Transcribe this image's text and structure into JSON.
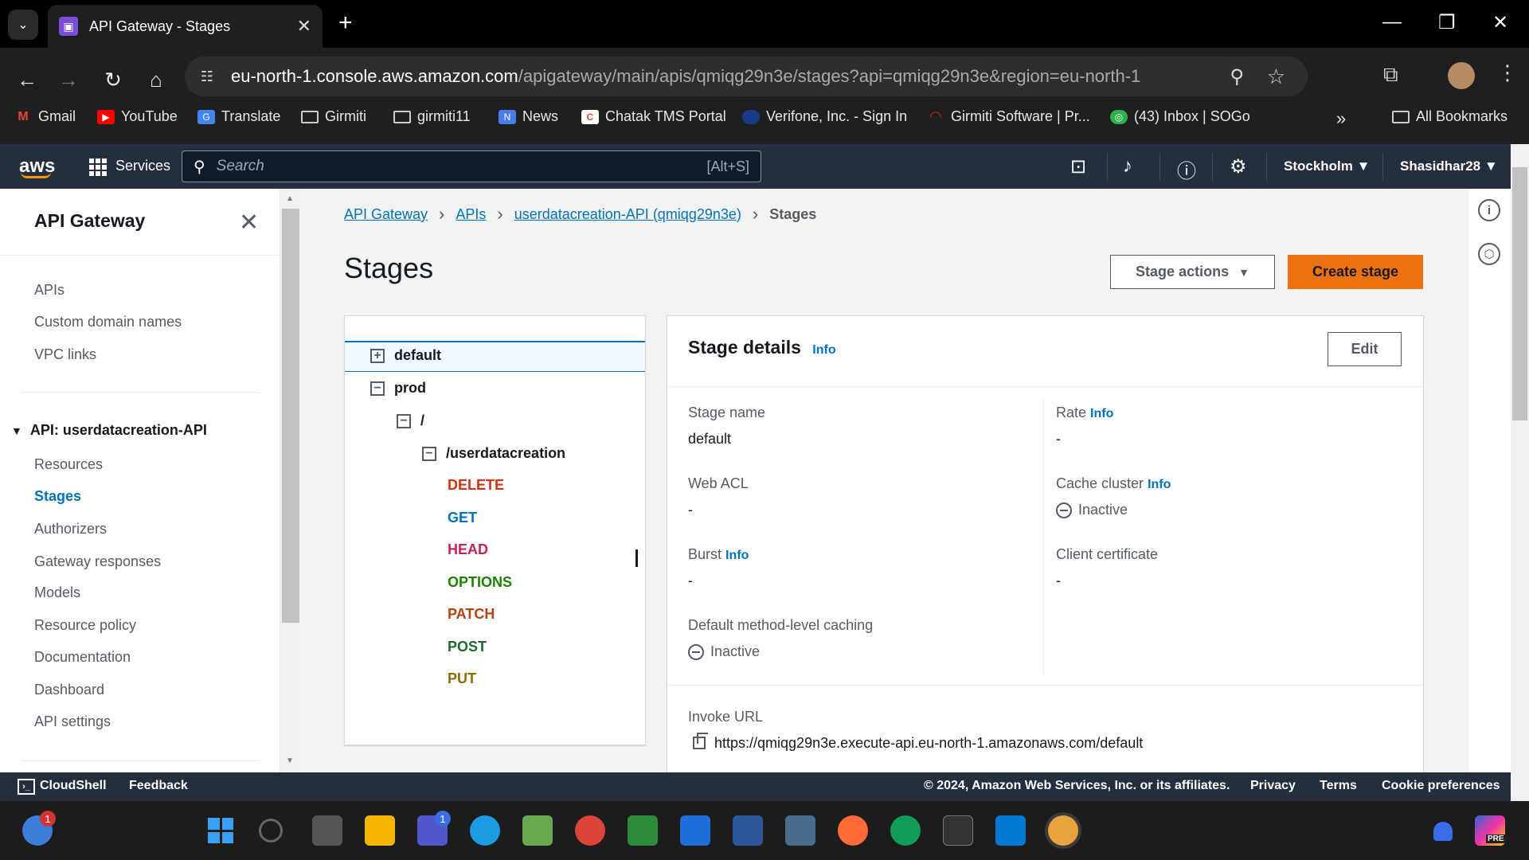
{
  "browser": {
    "tab_title": "API Gateway - Stages",
    "tab_close": "✕",
    "new_tab": "+",
    "url_host": "eu-north-1.console.aws.amazon.com",
    "url_path": "/apigateway/main/apis/qmiqg29n3e/stages?api=qmiqg29n3e&region=eu-north-1",
    "bookmarks": [
      {
        "label": "Gmail",
        "color": "#ea4335",
        "glyph": "M"
      },
      {
        "label": "YouTube",
        "color": "#ff0000",
        "glyph": "▶"
      },
      {
        "label": "Translate",
        "color": "#4285f4",
        "glyph": "G"
      },
      {
        "label": "Girmiti",
        "color": "",
        "glyph": ""
      },
      {
        "label": "girmiti11",
        "color": "",
        "glyph": ""
      },
      {
        "label": "News",
        "color": "#4a7de8",
        "glyph": "N"
      },
      {
        "label": "Chatak TMS Portal",
        "color": "#e84a2f",
        "glyph": "C"
      },
      {
        "label": "Verifone, Inc. - Sign In",
        "color": "#1a3a8a",
        "glyph": "●"
      },
      {
        "label": "Girmiti Software | Pr...",
        "color": "#d02020",
        "glyph": "◠"
      },
      {
        "label": "(43) Inbox | SOGo",
        "color": "#2bb24c",
        "glyph": "◎"
      }
    ],
    "more": "»",
    "all_bookmarks": "All Bookmarks"
  },
  "aws": {
    "logo": "aws",
    "services": "Services",
    "search_placeholder": "Search",
    "search_shortcut": "[Alt+S]",
    "region": "Stockholm ▼",
    "user": "Shasidhar28 ▼"
  },
  "sidebar": {
    "title": "API Gateway",
    "top_items": [
      "APIs",
      "Custom domain names",
      "VPC links"
    ],
    "api_section": "API: userdatacreation-API",
    "api_items": [
      "Resources",
      "Stages",
      "Authorizers",
      "Gateway responses",
      "Models",
      "Resource policy",
      "Documentation",
      "Dashboard",
      "API settings"
    ]
  },
  "breadcrumb": {
    "items": [
      "API Gateway",
      "APIs",
      "userdatacreation-API (qmiqg29n3e)"
    ],
    "current": "Stages"
  },
  "page": {
    "title": "Stages",
    "stage_actions": "Stage actions",
    "create_stage": "Create stage"
  },
  "tree": {
    "default": "default",
    "prod": "prod",
    "root": "/",
    "resource": "/userdatacreation",
    "methods": [
      {
        "name": "DELETE",
        "color": "#d13212"
      },
      {
        "name": "GET",
        "color": "#0073bb"
      },
      {
        "name": "HEAD",
        "color": "#c7254e"
      },
      {
        "name": "OPTIONS",
        "color": "#1d8102"
      },
      {
        "name": "PATCH",
        "color": "#b7410e"
      },
      {
        "name": "POST",
        "color": "#1d6b2c"
      },
      {
        "name": "PUT",
        "color": "#8a6d00"
      }
    ]
  },
  "details": {
    "title": "Stage details",
    "info": "Info",
    "edit": "Edit",
    "stage_name_label": "Stage name",
    "stage_name": "default",
    "rate_label": "Rate",
    "rate": "-",
    "web_acl_label": "Web ACL",
    "web_acl": "-",
    "cache_cluster_label": "Cache cluster",
    "cache_cluster": "Inactive",
    "burst_label": "Burst",
    "burst": "-",
    "client_cert_label": "Client certificate",
    "client_cert": "-",
    "caching_label": "Default method-level caching",
    "caching": "Inactive",
    "invoke_url_label": "Invoke URL",
    "invoke_url": "https://qmiqg29n3e.execute-api.eu-north-1.amazonaws.com/default"
  },
  "footer": {
    "cloudshell": "CloudShell",
    "feedback": "Feedback",
    "copyright": "© 2024, Amazon Web Services, Inc. or its affiliates.",
    "privacy": "Privacy",
    "terms": "Terms",
    "cookies": "Cookie preferences"
  },
  "taskbar": {
    "weather_badge": "1",
    "teams_badge": "1",
    "copilot_label": "PRE"
  }
}
